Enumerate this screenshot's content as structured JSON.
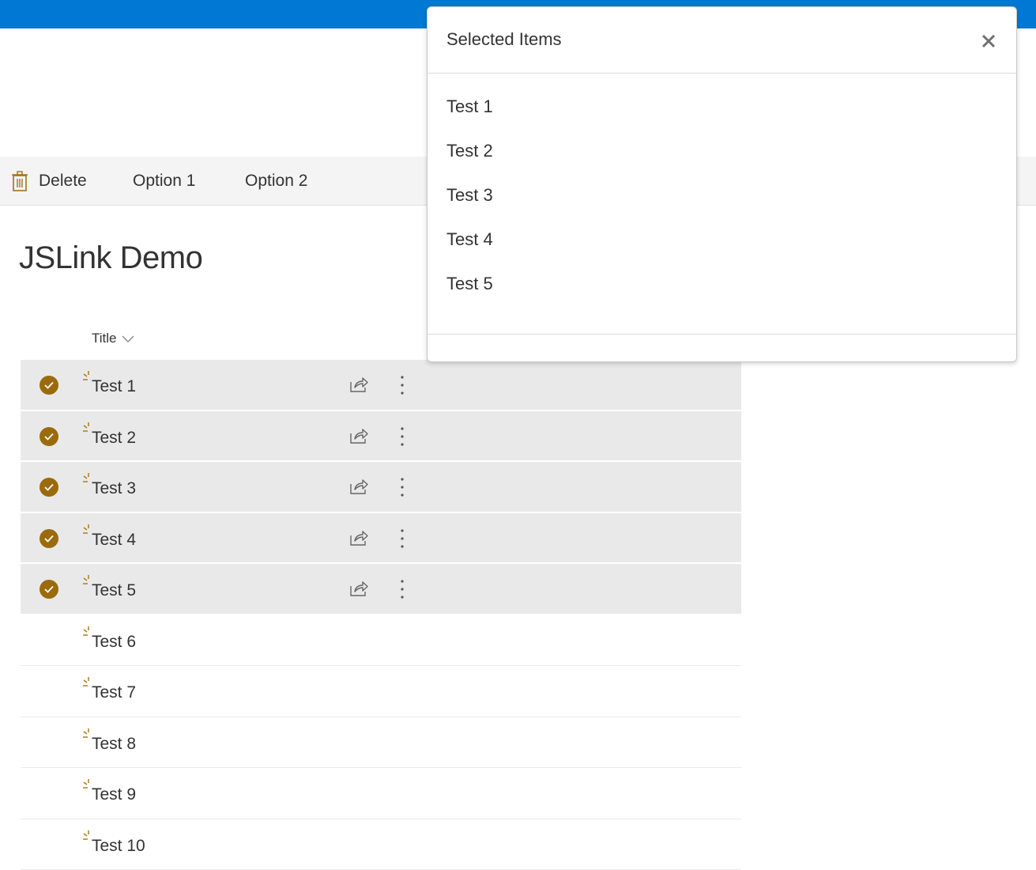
{
  "command_bar": {
    "delete_label": "Delete",
    "option1_label": "Option 1",
    "option2_label": "Option 2"
  },
  "page": {
    "title": "JSLink Demo"
  },
  "list": {
    "column_title": "Title",
    "rows": [
      {
        "title": "Test 1",
        "selected": true
      },
      {
        "title": "Test 2",
        "selected": true
      },
      {
        "title": "Test 3",
        "selected": true
      },
      {
        "title": "Test 4",
        "selected": true
      },
      {
        "title": "Test 5",
        "selected": true
      },
      {
        "title": "Test 6",
        "selected": false
      },
      {
        "title": "Test 7",
        "selected": false
      },
      {
        "title": "Test 8",
        "selected": false
      },
      {
        "title": "Test 9",
        "selected": false
      },
      {
        "title": "Test 10",
        "selected": false
      }
    ]
  },
  "dialog": {
    "title": "Selected Items",
    "close_icon": "close-icon",
    "items": [
      "Test 1",
      "Test 2",
      "Test 3",
      "Test 4",
      "Test 5"
    ]
  },
  "colors": {
    "suite_bar": "#0078d4",
    "accent": "#9b6b0b",
    "selected_row": "#e9e9e9"
  }
}
